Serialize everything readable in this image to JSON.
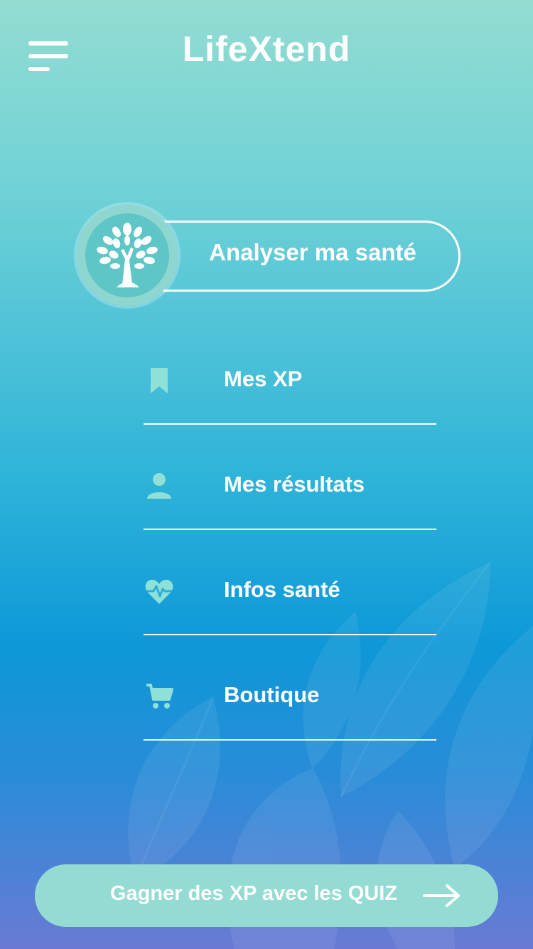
{
  "header": {
    "title": "LifeXtend",
    "menu_icon": "hamburger-menu-icon"
  },
  "analyse": {
    "label": "Analyser ma santé",
    "icon": "tree-icon"
  },
  "menu": {
    "items": [
      {
        "label": "Mes XP",
        "icon": "bookmark-icon"
      },
      {
        "label": "Mes résultats",
        "icon": "user-icon"
      },
      {
        "label": "Infos santé",
        "icon": "heart-pulse-icon"
      },
      {
        "label": "Boutique",
        "icon": "cart-icon"
      }
    ]
  },
  "quiz": {
    "label": "Gagner des XP avec les QUIZ",
    "icon": "arrow-right-icon"
  },
  "colors": {
    "accent": "#93dbd3",
    "icon": "#8fe0d7",
    "gradient_top": "#93dcd2",
    "gradient_mid": "#0d98d8",
    "gradient_bottom": "#6a7ad4"
  }
}
